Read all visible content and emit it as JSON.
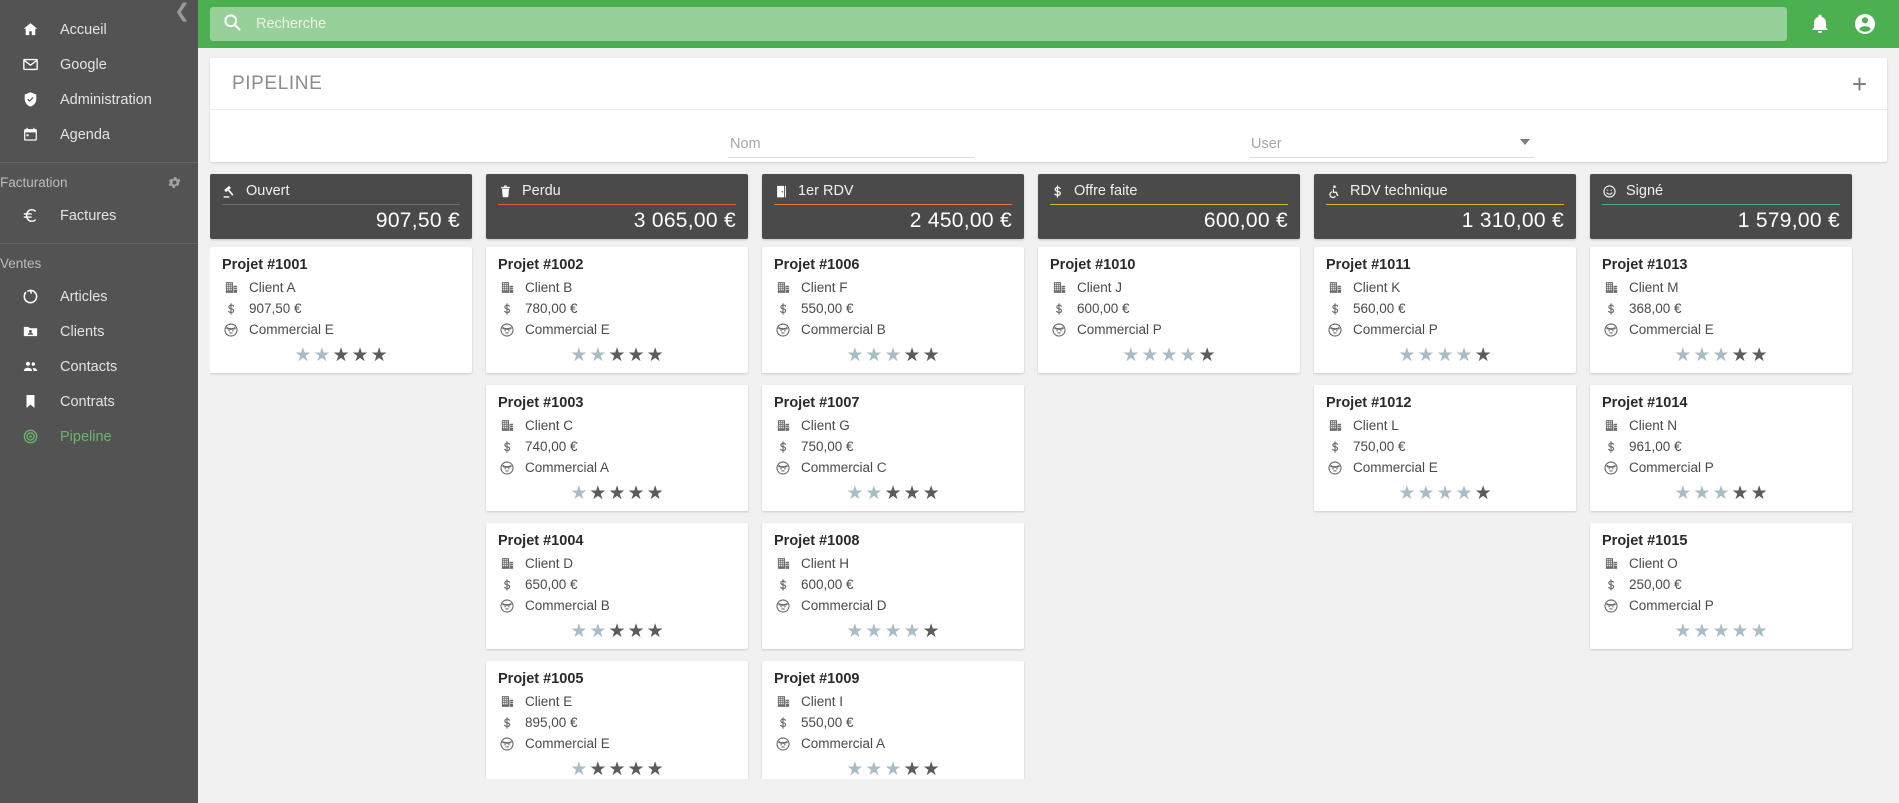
{
  "sidebar": {
    "collapse_icon": "chevron-left-icon",
    "items": [
      {
        "label": "Accueil",
        "icon": "home-icon",
        "active": false
      },
      {
        "label": "Google",
        "icon": "mail-icon",
        "active": false
      },
      {
        "label": "Administration",
        "icon": "shield-check-icon",
        "active": false
      },
      {
        "label": "Agenda",
        "icon": "calendar-icon",
        "active": false
      }
    ],
    "sections": [
      {
        "label": "Facturation",
        "gear_icon": "gear-icon",
        "items": [
          {
            "label": "Factures",
            "icon": "euro-icon",
            "active": false
          }
        ]
      },
      {
        "label": "Ventes",
        "gear_icon": null,
        "items": [
          {
            "label": "Articles",
            "icon": "donut-icon",
            "active": false
          },
          {
            "label": "Clients",
            "icon": "contact-folder-icon",
            "active": false
          },
          {
            "label": "Contacts",
            "icon": "people-icon",
            "active": false
          },
          {
            "label": "Contrats",
            "icon": "bookmark-icon",
            "active": false
          },
          {
            "label": "Pipeline",
            "icon": "target-icon",
            "active": true
          }
        ]
      }
    ]
  },
  "topbar": {
    "search": {
      "placeholder": "Recherche",
      "value": "",
      "icon": "search-icon"
    },
    "notification_icon": "bell-icon",
    "account_icon": "account-circle-icon",
    "accent_color": "#4caf50"
  },
  "panel": {
    "title": "PIPELINE",
    "add_label": "+",
    "add_icon": "plus-icon"
  },
  "filters": {
    "nom": {
      "placeholder": "Nom",
      "value": ""
    },
    "user": {
      "placeholder": "User",
      "value": "",
      "caret_icon": "chevron-down-icon"
    }
  },
  "board": {
    "columns": [
      {
        "name": "Ouvert",
        "icon": "gavel-icon",
        "rule_color": "#6e6e6e",
        "total": "907,50 €",
        "cards": [
          {
            "title": "Projet #1001",
            "client": "Client A",
            "amount": "907,50 €",
            "commercial": "Commercial E",
            "stars_light": 2,
            "stars_dark": 3
          }
        ]
      },
      {
        "name": "Perdu",
        "icon": "trash-icon",
        "rule_color": "#e05a4f",
        "total": "3 065,00 €",
        "cards": [
          {
            "title": "Projet #1002",
            "client": "Client B",
            "amount": "780,00 €",
            "commercial": "Commercial E",
            "stars_light": 2,
            "stars_dark": 3
          },
          {
            "title": "Projet #1003",
            "client": "Client C",
            "amount": "740,00 €",
            "commercial": "Commercial A",
            "stars_light": 1,
            "stars_dark": 4
          },
          {
            "title": "Projet #1004",
            "client": "Client D",
            "amount": "650,00 €",
            "commercial": "Commercial B",
            "stars_light": 2,
            "stars_dark": 3
          },
          {
            "title": "Projet #1005",
            "client": "Client E",
            "amount": "895,00 €",
            "commercial": "Commercial E",
            "stars_light": 1,
            "stars_dark": 4
          }
        ]
      },
      {
        "name": "1er RDV",
        "icon": "door-icon",
        "rule_color": "#e07b39",
        "total": "2 450,00 €",
        "cards": [
          {
            "title": "Projet #1006",
            "client": "Client F",
            "amount": "550,00 €",
            "commercial": "Commercial B",
            "stars_light": 3,
            "stars_dark": 2
          },
          {
            "title": "Projet #1007",
            "client": "Client G",
            "amount": "750,00 €",
            "commercial": "Commercial C",
            "stars_light": 2,
            "stars_dark": 3
          },
          {
            "title": "Projet #1008",
            "client": "Client H",
            "amount": "600,00 €",
            "commercial": "Commercial D",
            "stars_light": 4,
            "stars_dark": 1
          },
          {
            "title": "Projet #1009",
            "client": "Client I",
            "amount": "550,00 €",
            "commercial": "Commercial A",
            "stars_light": 3,
            "stars_dark": 2
          }
        ]
      },
      {
        "name": "Offre faite",
        "icon": "dollar-icon",
        "rule_color": "#d4b430",
        "total": "600,00 €",
        "cards": [
          {
            "title": "Projet #1010",
            "client": "Client J",
            "amount": "600,00 €",
            "commercial": "Commercial P",
            "stars_light": 4,
            "stars_dark": 1
          }
        ]
      },
      {
        "name": "RDV technique",
        "icon": "wheelchair-icon",
        "rule_color": "#d4b430",
        "total": "1 310,00 €",
        "cards": [
          {
            "title": "Projet #1011",
            "client": "Client K",
            "amount": "560,00 €",
            "commercial": "Commercial P",
            "stars_light": 4,
            "stars_dark": 1
          },
          {
            "title": "Projet #1012",
            "client": "Client L",
            "amount": "750,00 €",
            "commercial": "Commercial E",
            "stars_light": 4,
            "stars_dark": 1
          }
        ]
      },
      {
        "name": "Signé",
        "icon": "smiley-icon",
        "rule_color": "#4caf7d",
        "total": "1 579,00 €",
        "cards": [
          {
            "title": "Projet #1013",
            "client": "Client M",
            "amount": "368,00 €",
            "commercial": "Commercial E",
            "stars_light": 3,
            "stars_dark": 2
          },
          {
            "title": "Projet #1014",
            "client": "Client N",
            "amount": "961,00 €",
            "commercial": "Commercial P",
            "stars_light": 3,
            "stars_dark": 2
          },
          {
            "title": "Projet #1015",
            "client": "Client O",
            "amount": "250,00 €",
            "commercial": "Commercial P",
            "stars_light": 5,
            "stars_dark": 0
          }
        ]
      }
    ],
    "card_icons": {
      "client": "building-icon",
      "amount": "dollar-icon",
      "commercial": "face-icon",
      "star": "star-icon"
    }
  }
}
